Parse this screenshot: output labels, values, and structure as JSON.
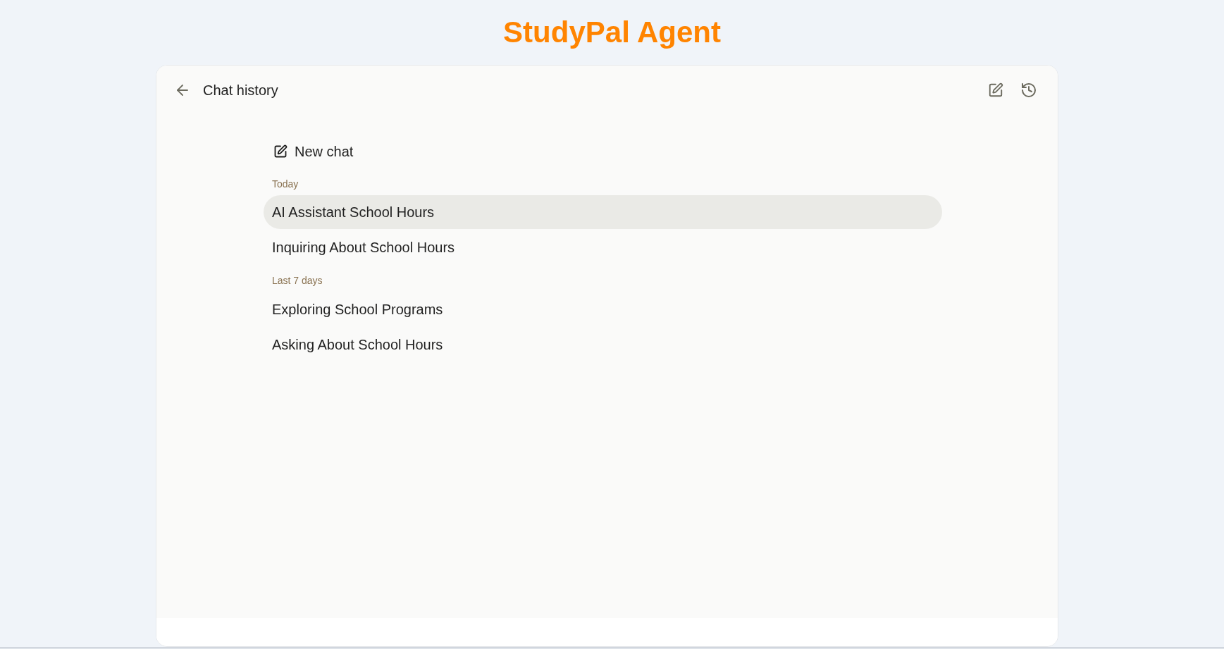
{
  "app_title": "StudyPal Agent",
  "header": {
    "title": "Chat history"
  },
  "new_chat": {
    "label": "New chat"
  },
  "groups": [
    {
      "label": "Today",
      "chats": [
        {
          "title": "AI Assistant School Hours",
          "selected": true
        },
        {
          "title": "Inquiring About School Hours",
          "selected": false
        }
      ]
    },
    {
      "label": "Last 7 days",
      "chats": [
        {
          "title": "Exploring School Programs",
          "selected": false
        },
        {
          "title": "Asking About School Hours",
          "selected": false
        }
      ]
    }
  ]
}
